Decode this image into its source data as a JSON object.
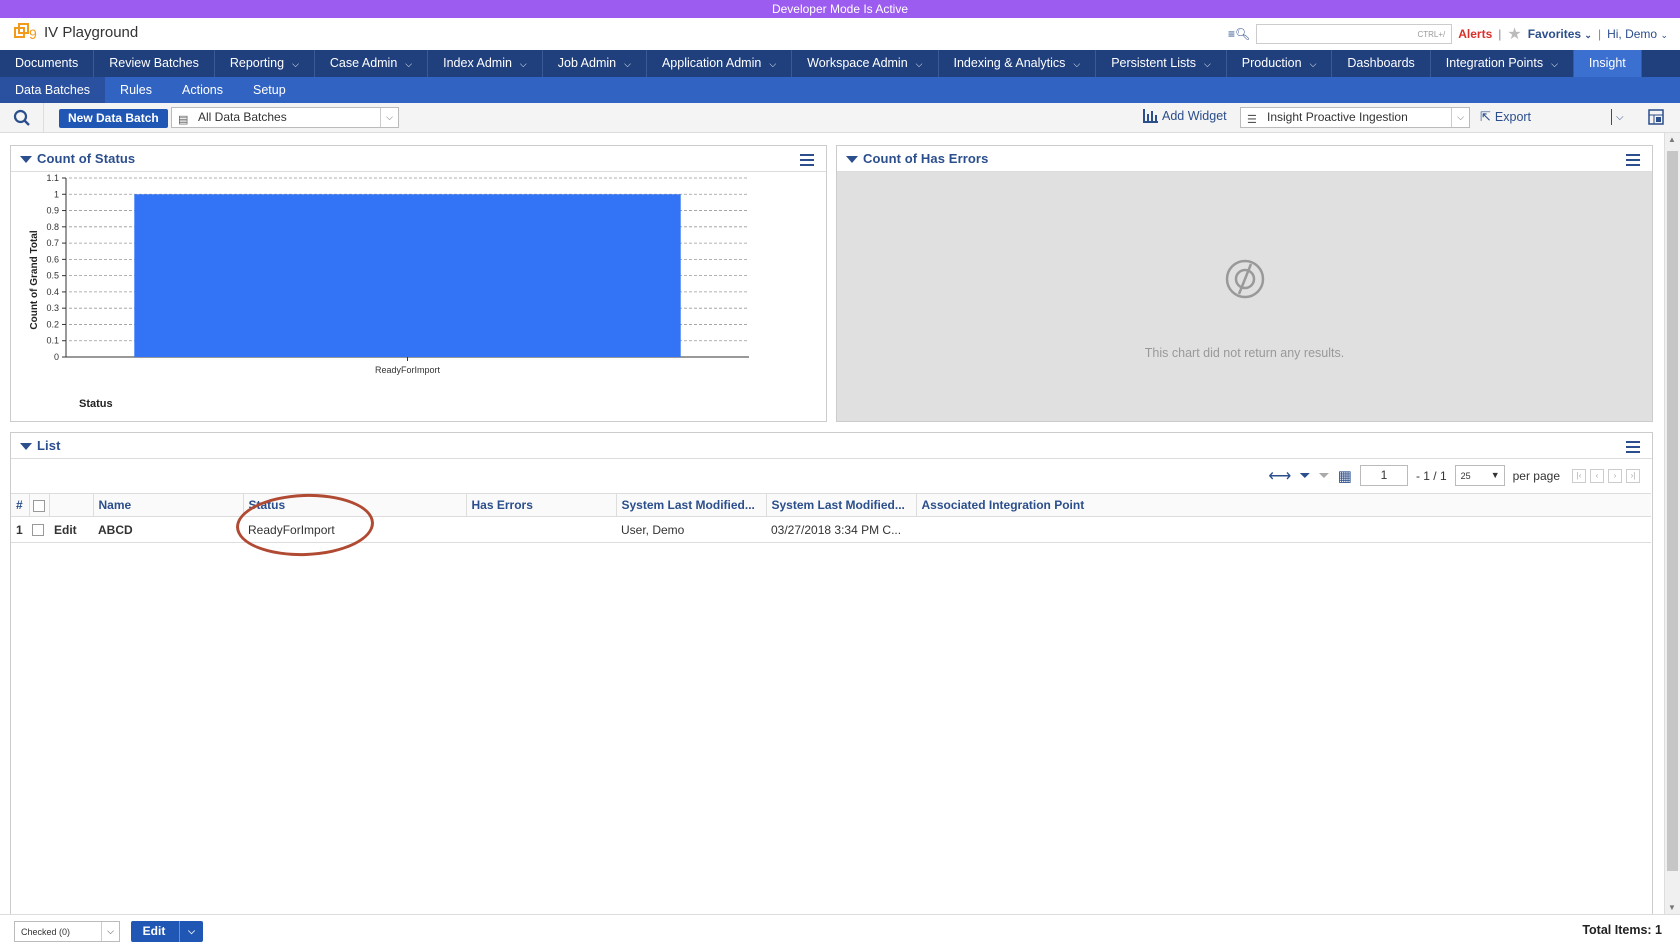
{
  "devbar": {
    "text": "Developer Mode Is Active"
  },
  "header": {
    "app_title": "IV Playground",
    "search_shortcut": "CTRL+/",
    "alerts": "Alerts",
    "favorites": "Favorites",
    "greeting": "Hi, Demo"
  },
  "topnav": [
    {
      "label": "Documents",
      "dropdown": false
    },
    {
      "label": "Review Batches",
      "dropdown": false
    },
    {
      "label": "Reporting",
      "dropdown": true
    },
    {
      "label": "Case Admin",
      "dropdown": true
    },
    {
      "label": "Index Admin",
      "dropdown": true
    },
    {
      "label": "Job Admin",
      "dropdown": true
    },
    {
      "label": "Application Admin",
      "dropdown": true
    },
    {
      "label": "Workspace Admin",
      "dropdown": true
    },
    {
      "label": "Indexing & Analytics",
      "dropdown": true
    },
    {
      "label": "Persistent Lists",
      "dropdown": true
    },
    {
      "label": "Production",
      "dropdown": true
    },
    {
      "label": "Dashboards",
      "dropdown": false
    },
    {
      "label": "Integration Points",
      "dropdown": true
    },
    {
      "label": "Insight",
      "dropdown": false,
      "active": true
    }
  ],
  "subnav": [
    {
      "label": "Data Batches",
      "active": true
    },
    {
      "label": "Rules"
    },
    {
      "label": "Actions"
    },
    {
      "label": "Setup"
    }
  ],
  "toolbar": {
    "new_button": "New Data Batch",
    "view_select": "All Data Batches",
    "add_widget": "Add Widget",
    "dashboard_select": "Insight Proactive Ingestion",
    "export": "Export"
  },
  "panels": {
    "status": {
      "title": "Count of Status"
    },
    "errors": {
      "title": "Count of Has Errors",
      "empty_message": "This chart did not return any results."
    },
    "list": {
      "title": "List"
    }
  },
  "chart_data": {
    "type": "bar",
    "categories": [
      "ReadyForImport"
    ],
    "values": [
      1
    ],
    "xlabel": "Status",
    "ylabel": "Count of Grand Total",
    "ylim": [
      0,
      1.1
    ],
    "yticks": [
      "0",
      "0.1",
      "0.2",
      "0.3",
      "0.4",
      "0.5",
      "0.6",
      "0.7",
      "0.8",
      "0.9",
      "1",
      "1.1"
    ],
    "color": "#3373f5",
    "grid": "dashed horizontal"
  },
  "grid": {
    "page_value": "1",
    "page_total": "- 1 / 1",
    "per_page_value": "25",
    "per_page_label": "per page",
    "columns": [
      "#",
      "",
      "",
      "Name",
      "Status",
      "Has Errors",
      "System Last Modified...",
      "System Last Modified...",
      "Associated Integration Point"
    ],
    "rows": [
      {
        "num": "1",
        "edit": "Edit",
        "name": "ABCD",
        "status": "ReadyForImport",
        "has_errors": "",
        "modified_by": "User, Demo",
        "modified_on": "03/27/2018 3:34 PM C...",
        "integration_point": ""
      }
    ]
  },
  "footer": {
    "checked_select": "Checked (0)",
    "edit_button": "Edit",
    "total_items": "Total Items: 1"
  }
}
